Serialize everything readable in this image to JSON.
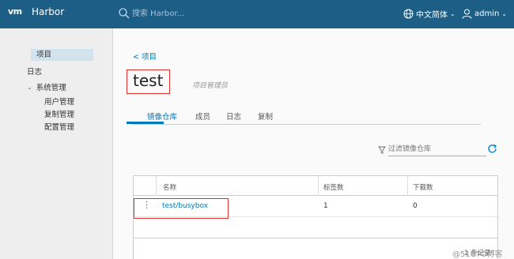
{
  "header": {
    "logo": "vm",
    "app_title": "Harbor",
    "search_placeholder": "搜索 Harbor...",
    "language": "中文简体",
    "user": "admin"
  },
  "sidebar": {
    "items": [
      {
        "label": "项目",
        "active": true
      },
      {
        "label": "日志"
      },
      {
        "label": "系统管理",
        "expanded": true
      },
      {
        "label": "用户管理"
      },
      {
        "label": "复制管理"
      },
      {
        "label": "配置管理"
      }
    ]
  },
  "main": {
    "back_link": "< 项目",
    "project_name": "test",
    "project_role": "项目管理员",
    "tabs": [
      "镜像仓库",
      "成员",
      "日志",
      "复制"
    ],
    "filter_placeholder": "过滤镜像仓库",
    "table": {
      "columns": [
        "名称",
        "标签数",
        "下载数"
      ],
      "rows": [
        {
          "name": "test/busybox",
          "tags": "1",
          "pulls": "0"
        }
      ],
      "footer": "1 条记录"
    }
  },
  "watermark": "@51CTO博客",
  "colors": {
    "header_bg": "#1d5e87",
    "accent": "#0079b8",
    "highlight_box": "#e2312d"
  }
}
